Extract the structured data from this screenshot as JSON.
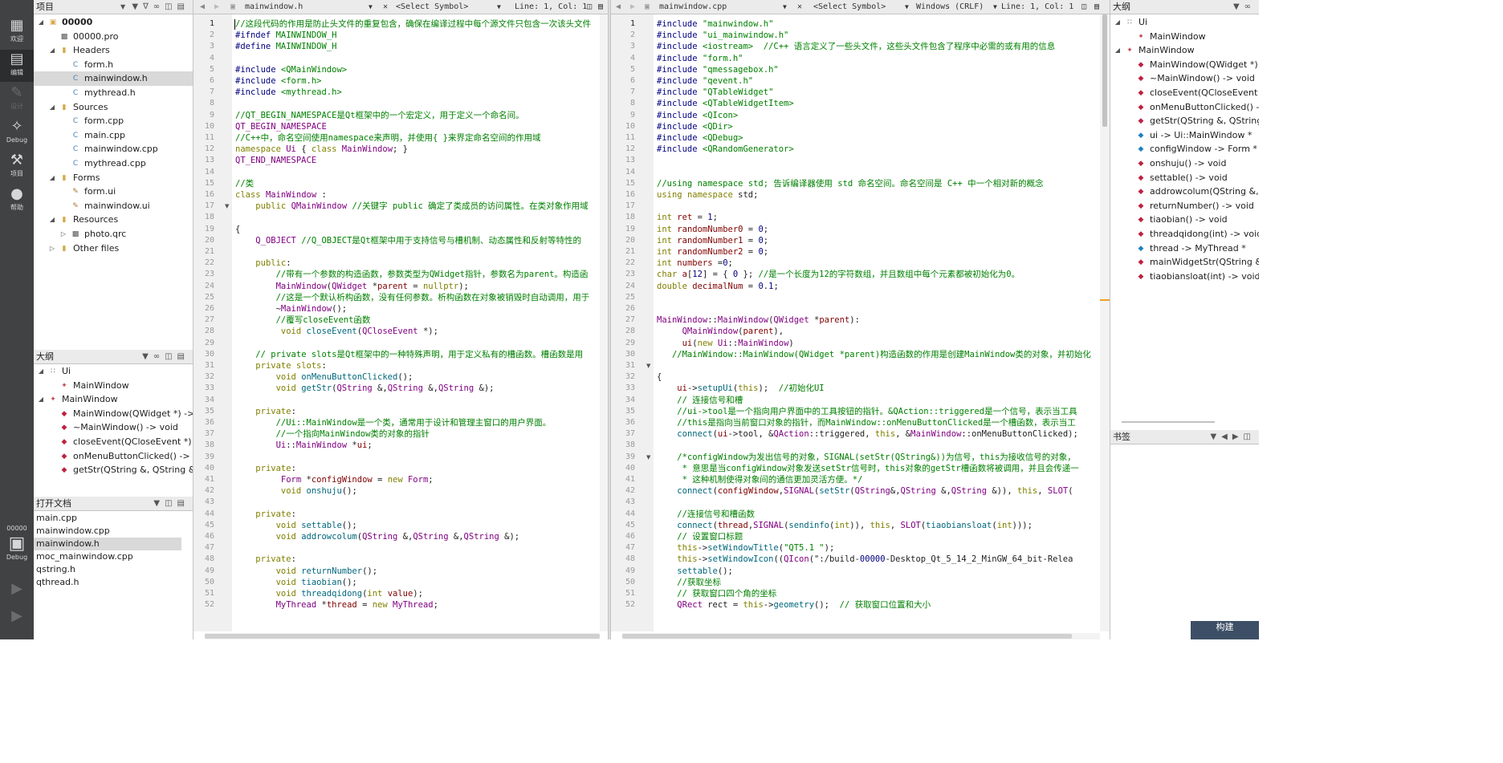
{
  "colors": {
    "modebar": "#404244",
    "panel_header": "#ebebeb",
    "selection": "#d9d9d9",
    "keyword": "#808000",
    "comment": "#008000",
    "type": "#800080"
  },
  "modebar": [
    {
      "label": "欢迎",
      "icon": "grid-icon"
    },
    {
      "label": "编辑",
      "icon": "edit-icon"
    },
    {
      "label": "设计",
      "icon": "pen-icon"
    },
    {
      "label": "Debug",
      "icon": "bug-icon"
    },
    {
      "label": "项目",
      "icon": "wrench-icon"
    },
    {
      "label": "帮助",
      "icon": "help-icon"
    }
  ],
  "kit": {
    "project": "00000",
    "label": "Debug"
  },
  "project_panel": {
    "title": "项目",
    "items": [
      {
        "label": "00000",
        "level": 0,
        "exp": "open",
        "bold": true,
        "icon": "project-icon"
      },
      {
        "label": "00000.pro",
        "level": 1,
        "exp": "",
        "icon": "pro-file-icon"
      },
      {
        "label": "Headers",
        "level": 1,
        "exp": "open",
        "icon": "folder-icon"
      },
      {
        "label": "form.h",
        "level": 2,
        "exp": "",
        "icon": "header-file-icon"
      },
      {
        "label": "mainwindow.h",
        "level": 2,
        "exp": "",
        "icon": "header-file-icon",
        "sel": true
      },
      {
        "label": "mythread.h",
        "level": 2,
        "exp": "",
        "icon": "header-file-icon"
      },
      {
        "label": "Sources",
        "level": 1,
        "exp": "open",
        "icon": "folder-icon"
      },
      {
        "label": "form.cpp",
        "level": 2,
        "exp": "",
        "icon": "cpp-file-icon"
      },
      {
        "label": "main.cpp",
        "level": 2,
        "exp": "",
        "icon": "cpp-file-icon"
      },
      {
        "label": "mainwindow.cpp",
        "level": 2,
        "exp": "",
        "icon": "cpp-file-icon"
      },
      {
        "label": "mythread.cpp",
        "level": 2,
        "exp": "",
        "icon": "cpp-file-icon"
      },
      {
        "label": "Forms",
        "level": 1,
        "exp": "open",
        "icon": "folder-icon"
      },
      {
        "label": "form.ui",
        "level": 2,
        "exp": "",
        "icon": "ui-file-icon"
      },
      {
        "label": "mainwindow.ui",
        "level": 2,
        "exp": "",
        "icon": "ui-file-icon"
      },
      {
        "label": "Resources",
        "level": 1,
        "exp": "open",
        "icon": "folder-icon"
      },
      {
        "label": "photo.qrc",
        "level": 2,
        "exp": "closed",
        "icon": "qrc-file-icon"
      },
      {
        "label": "Other files",
        "level": 1,
        "exp": "closed",
        "icon": "folder-icon"
      }
    ]
  },
  "outline_left": {
    "title": "大纲",
    "items": [
      {
        "label": "Ui",
        "level": 0,
        "exp": "open",
        "icon": "namespace-icon"
      },
      {
        "label": "MainWindow",
        "level": 1,
        "exp": "",
        "icon": "class-icon"
      },
      {
        "label": "MainWindow",
        "level": 0,
        "exp": "open",
        "icon": "class-icon"
      },
      {
        "label": "MainWindow(QWidget *) ->",
        "level": 1,
        "exp": "",
        "icon": "method-icon"
      },
      {
        "label": "~MainWindow() -> void",
        "level": 1,
        "exp": "",
        "icon": "method-icon"
      },
      {
        "label": "closeEvent(QCloseEvent *) ·",
        "level": 1,
        "exp": "",
        "icon": "method-icon"
      },
      {
        "label": "onMenuButtonClicked() ->",
        "level": 1,
        "exp": "",
        "icon": "slot-icon"
      },
      {
        "label": "getStr(QString &, QString &",
        "level": 1,
        "exp": "",
        "icon": "slot-icon"
      }
    ]
  },
  "open_docs": {
    "title": "打开文档",
    "items": [
      "main.cpp",
      "mainwindow.cpp",
      "mainwindow.h",
      "moc_mainwindow.cpp",
      "qstring.h",
      "qthread.h"
    ],
    "selected": "mainwindow.h"
  },
  "editor1": {
    "file": "mainwindow.h",
    "symbol": "<Select Symbol>",
    "position": "Line: 1, Col: 1",
    "lines": [
      "//这段代码的作用是防止头文件的重复包含，确保在编译过程中每个源文件只包含一次该头文件",
      "#ifndef MAINWINDOW_H",
      "#define MAINWINDOW_H",
      "",
      "#include <QMainWindow>",
      "#include <form.h>",
      "#include <mythread.h>",
      "",
      "//QT_BEGIN_NAMESPACE是Qt框架中的一个宏定义，用于定义一个命名间。",
      "QT_BEGIN_NAMESPACE",
      "//C++中，命名空间使用namespace来声明，并使用{ }来界定命名空间的作用域",
      "namespace Ui { class MainWindow; }",
      "QT_END_NAMESPACE",
      "",
      "//类",
      "class MainWindow :",
      "    public QMainWindow //关键字 public 确定了类成员的访问属性。在类对象作用域",
      "",
      "{",
      "    Q_OBJECT //Q_OBJECT是Qt框架中用于支持信号与槽机制、动态属性和反射等特性的",
      "",
      "    public:",
      "        //带有一个参数的构造函数，参数类型为QWidget指针，参数名为parent。构造函",
      "        MainWindow(QWidget *parent = nullptr);",
      "        //这是一个默认析构函数，没有任何参数。析构函数在对象被销毁时自动调用，用于",
      "        ~MainWindow();",
      "        //覆写closeEvent函数",
      "         void closeEvent(QCloseEvent *);",
      "",
      "    // private slots是Qt框架中的一种特殊声明，用于定义私有的槽函数。槽函数是用",
      "    private slots:",
      "        void onMenuButtonClicked();",
      "        void getStr(QString &,QString &,QString &);",
      "",
      "    private:",
      "        //Ui::MainWindow是一个类，通常用于设计和管理主窗口的用户界面。",
      "        //一个指向MainWindow类的对象的指针",
      "        Ui::MainWindow *ui;",
      "",
      "    private:",
      "         Form *configWindow = new Form;",
      "         void onshuju();",
      "",
      "    private:",
      "        void settable();",
      "        void addrowcolum(QString &,QString &,QString &);",
      "",
      "    private:",
      "        void returnNumber();",
      "        void tiaobian();",
      "        void threadqidong(int value);",
      "        MyThread *thread = new MyThread;"
    ]
  },
  "editor2": {
    "file": "mainwindow.cpp",
    "symbol": "<Select Symbol>",
    "encoding": "Windows (CRLF)",
    "position": "Line: 1, Col: 1",
    "lines": [
      "#include \"mainwindow.h\"",
      "#include \"ui_mainwindow.h\"",
      "#include <iostream>  //C++ 语言定义了一些头文件，这些头文件包含了程序中必需的或有用的信息",
      "#include \"form.h\"",
      "#include \"qmessagebox.h\"",
      "#include \"qevent.h\"",
      "#include \"QTableWidget\"",
      "#include <QTableWidgetItem>",
      "#include <QIcon>",
      "#include <QDir>",
      "#include <QDebug>",
      "#include <QRandomGenerator>",
      "",
      "",
      "//using namespace std; 告诉编译器使用 std 命名空间。命名空间是 C++ 中一个相对新的概念",
      "using namespace std;",
      "",
      "int ret = 1;",
      "int randomNumber0 = 0;",
      "int randomNumber1 = 0;",
      "int randomNumber2 = 0;",
      "int numbers =0;",
      "char a[12] = { 0 }; //是一个长度为12的字符数组，并且数组中每个元素都被初始化为0。",
      "double decimalNum = 0.1;",
      "",
      "",
      "MainWindow::MainWindow(QWidget *parent):",
      "     QMainWindow(parent),",
      "     ui(new Ui::MainWindow)",
      "   //MainWindow::MainWindow(QWidget *parent)构造函数的作用是创建MainWindow类的对象，并初始化",
      "",
      "{",
      "    ui->setupUi(this);  //初始化UI",
      "    // 连接信号和槽",
      "    //ui->tool是一个指向用户界面中的工具按钮的指针。&QAction::triggered是一个信号，表示当工具",
      "    //this是指向当前窗口对象的指针，而MainWindow::onMenuButtonClicked是一个槽函数，表示当工",
      "    connect(ui->tool, &QAction::triggered, this, &MainWindow::onMenuButtonClicked);",
      "",
      "    /*configWindow为发出信号的对象，SIGNAL(setStr(QString&))为信号，this为接收信号的对象，",
      "     * 意思是当configWindow对象发送setStr信号时，this对象的getStr槽函数将被调用，并且会传递一",
      "     * 这种机制使得对象间的通信更加灵活方便。*/",
      "    connect(configWindow,SIGNAL(setStr(QString&,QString &,QString &)), this, SLOT(",
      "",
      "    //连接信号和槽函数",
      "    connect(thread,SIGNAL(sendinfo(int)), this, SLOT(tiaobiansloat(int)));",
      "    // 设置窗口标题",
      "    this->setWindowTitle(\"QT5.1 \");",
      "    this->setWindowIcon((QIcon(\":/build-00000-Desktop_Qt_5_14_2_MinGW_64_bit-Relea",
      "    settable();",
      "    //获取坐标",
      "    // 获取窗口四个角的坐标",
      "    QRect rect = this->geometry();  // 获取窗口位置和大小"
    ]
  },
  "outline_right": {
    "title": "大纲",
    "items": [
      {
        "label": "Ui",
        "level": 0,
        "exp": "open",
        "icon": "namespace-icon"
      },
      {
        "label": "MainWindow",
        "level": 1,
        "exp": "",
        "icon": "class-icon"
      },
      {
        "label": "MainWindow",
        "level": 0,
        "exp": "open",
        "icon": "class-icon"
      },
      {
        "label": "MainWindow(QWidget *) ->",
        "level": 1,
        "exp": "",
        "icon": "method-icon"
      },
      {
        "label": "~MainWindow() -> void",
        "level": 1,
        "exp": "",
        "icon": "method-icon"
      },
      {
        "label": "closeEvent(QCloseEvent *) -",
        "level": 1,
        "exp": "",
        "icon": "method-icon"
      },
      {
        "label": "onMenuButtonClicked() ->",
        "level": 1,
        "exp": "",
        "icon": "slot-icon"
      },
      {
        "label": "getStr(QString &, QString &",
        "level": 1,
        "exp": "",
        "icon": "slot-icon"
      },
      {
        "label": "ui -> Ui::MainWindow *",
        "level": 1,
        "exp": "",
        "icon": "field-icon"
      },
      {
        "label": "configWindow -> Form *",
        "level": 1,
        "exp": "",
        "icon": "field-icon"
      },
      {
        "label": "onshuju() -> void",
        "level": 1,
        "exp": "",
        "icon": "slot-icon"
      },
      {
        "label": "settable() -> void",
        "level": 1,
        "exp": "",
        "icon": "slot-icon"
      },
      {
        "label": "addrowcolum(QString &, Q",
        "level": 1,
        "exp": "",
        "icon": "slot-icon"
      },
      {
        "label": "returnNumber() -> void",
        "level": 1,
        "exp": "",
        "icon": "slot-icon"
      },
      {
        "label": "tiaobian() -> void",
        "level": 1,
        "exp": "",
        "icon": "slot-icon"
      },
      {
        "label": "threadqidong(int) -> void",
        "level": 1,
        "exp": "",
        "icon": "slot-icon"
      },
      {
        "label": "thread -> MyThread *",
        "level": 1,
        "exp": "",
        "icon": "field-icon"
      },
      {
        "label": "mainWidgetStr(QString &, Q",
        "level": 1,
        "exp": "",
        "icon": "slot-icon"
      },
      {
        "label": "tiaobiansloat(int) -> void",
        "level": 1,
        "exp": "",
        "icon": "slot-icon"
      }
    ]
  },
  "bookmarks": {
    "title": "书签"
  },
  "build_button": "构建"
}
